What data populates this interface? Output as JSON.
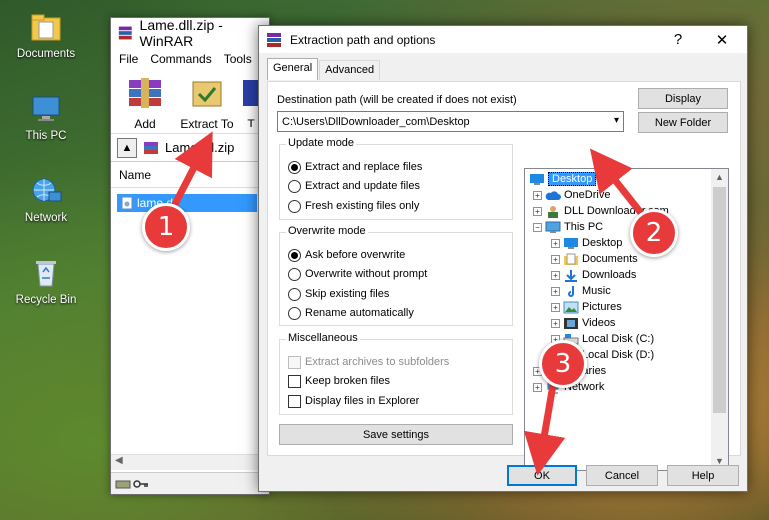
{
  "desktop": {
    "icons": [
      {
        "label": "Documents"
      },
      {
        "label": "This PC"
      },
      {
        "label": "Network"
      },
      {
        "label": "Recycle Bin"
      }
    ]
  },
  "winrar": {
    "title": "Lame.dll.zip - WinRAR",
    "menu": [
      "File",
      "Commands",
      "Tools"
    ],
    "toolbar": [
      {
        "label": "Add"
      },
      {
        "label": "Extract To"
      },
      {
        "label": "T"
      }
    ],
    "address": "Lame.dll.zip",
    "column_name": "Name",
    "file": "lame.dll"
  },
  "dialog": {
    "title": "Extraction path and options",
    "help_glyph": "?",
    "close_glyph": "✕",
    "tabs": [
      "General",
      "Advanced"
    ],
    "dest_label": "Destination path (will be created if does not exist)",
    "dest_value": "C:\\Users\\DllDownloader_com\\Desktop",
    "display_button": "Display",
    "new_folder_button": "New Folder",
    "update_mode": {
      "title": "Update mode",
      "options": [
        "Extract and replace files",
        "Extract and update files",
        "Fresh existing files only"
      ],
      "selected": 0
    },
    "overwrite_mode": {
      "title": "Overwrite mode",
      "options": [
        "Ask before overwrite",
        "Overwrite without prompt",
        "Skip existing files",
        "Rename automatically"
      ],
      "selected": 0
    },
    "misc": {
      "title": "Miscellaneous",
      "options": [
        "Extract archives to subfolders",
        "Keep broken files",
        "Display files in Explorer"
      ]
    },
    "save_settings": "Save settings",
    "tree": [
      {
        "label": "Desktop"
      },
      {
        "label": "OneDrive"
      },
      {
        "label": "DLL Downloader.com"
      },
      {
        "label": "This PC"
      },
      {
        "label": "Desktop"
      },
      {
        "label": "Documents"
      },
      {
        "label": "Downloads"
      },
      {
        "label": "Music"
      },
      {
        "label": "Pictures"
      },
      {
        "label": "Videos"
      },
      {
        "label": "Local Disk (C:)"
      },
      {
        "label": "Local Disk (D:)"
      },
      {
        "label": "Libraries"
      },
      {
        "label": "Network"
      }
    ],
    "ok": "OK",
    "cancel": "Cancel",
    "help": "Help"
  },
  "callouts": [
    "1",
    "2",
    "3"
  ],
  "colors": {
    "selection": "#3399ff",
    "callout": "#e83a3a",
    "arrow": "#e83a3a",
    "focus": "#0078d7"
  }
}
